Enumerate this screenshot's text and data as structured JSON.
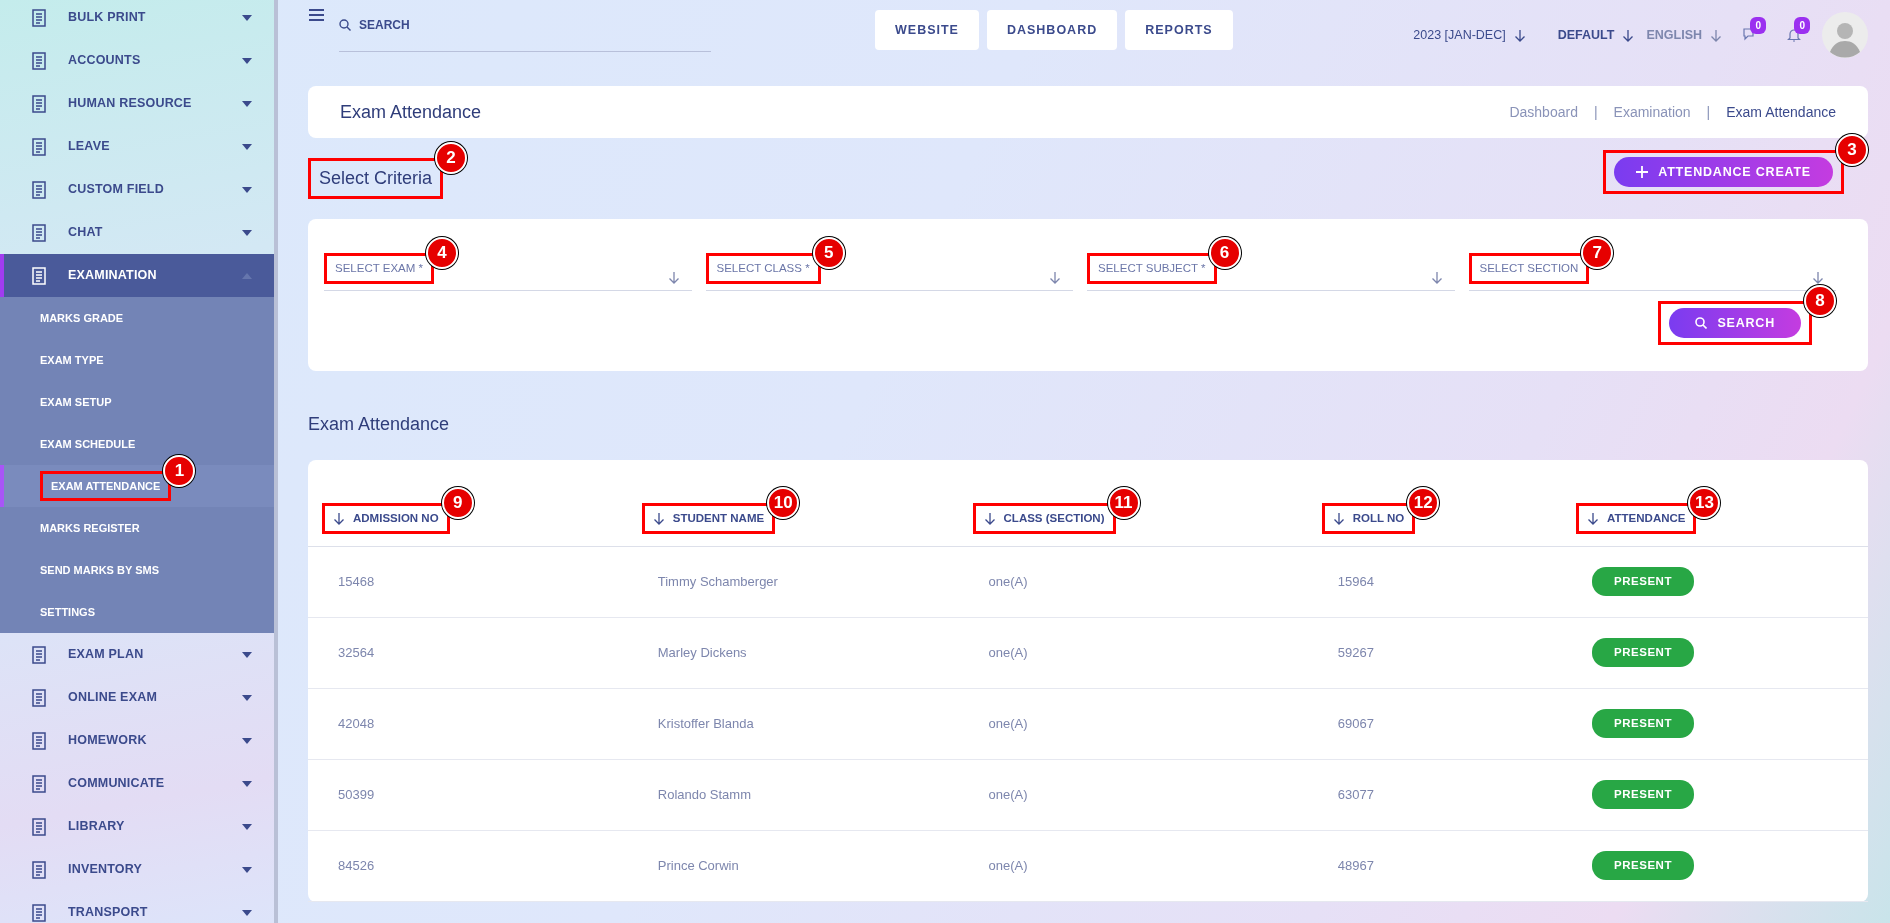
{
  "sidebar": {
    "items": [
      {
        "label": "BULK PRINT",
        "expanded": false,
        "selected": false
      },
      {
        "label": "ACCOUNTS",
        "expanded": false,
        "selected": false
      },
      {
        "label": "HUMAN RESOURCE",
        "expanded": false,
        "selected": false
      },
      {
        "label": "LEAVE",
        "expanded": false,
        "selected": false
      },
      {
        "label": "CUSTOM FIELD",
        "expanded": false,
        "selected": false
      },
      {
        "label": "CHAT",
        "expanded": false,
        "selected": false
      },
      {
        "label": "EXAMINATION",
        "expanded": true,
        "selected": true,
        "children": [
          {
            "label": "MARKS GRADE",
            "selected": false
          },
          {
            "label": "EXAM TYPE",
            "selected": false
          },
          {
            "label": "EXAM SETUP",
            "selected": false
          },
          {
            "label": "EXAM SCHEDULE",
            "selected": false
          },
          {
            "label": "EXAM ATTENDANCE",
            "selected": true,
            "callout": "1"
          },
          {
            "label": "MARKS REGISTER",
            "selected": false
          },
          {
            "label": "SEND MARKS BY SMS",
            "selected": false
          },
          {
            "label": "SETTINGS",
            "selected": false
          }
        ]
      },
      {
        "label": "EXAM PLAN",
        "expanded": false,
        "selected": false
      },
      {
        "label": "ONLINE EXAM",
        "expanded": false,
        "selected": false
      },
      {
        "label": "HOMEWORK",
        "expanded": false,
        "selected": false
      },
      {
        "label": "COMMUNICATE",
        "expanded": false,
        "selected": false
      },
      {
        "label": "LIBRARY",
        "expanded": false,
        "selected": false
      },
      {
        "label": "INVENTORY",
        "expanded": false,
        "selected": false
      },
      {
        "label": "TRANSPORT",
        "expanded": false,
        "selected": false
      }
    ]
  },
  "topbar": {
    "search": {
      "placeholder": "SEARCH"
    },
    "nav_buttons": [
      "WEBSITE",
      "DASHBOARD",
      "REPORTS"
    ],
    "session": "2023 [JAN-DEC]",
    "theme": "DEFAULT",
    "language": "ENGLISH",
    "message_count": "0",
    "notification_count": "0"
  },
  "page_header": {
    "title": "Exam Attendance",
    "separator": "|",
    "breadcrumb": [
      {
        "label": "Dashboard",
        "selected": false
      },
      {
        "label": "Examination",
        "selected": false
      },
      {
        "label": "Exam Attendance",
        "selected": true
      }
    ]
  },
  "criteria": {
    "title": "Select Criteria",
    "title_callout": "2",
    "create_button": {
      "label": "ATTENDANCE CREATE",
      "callout": "3"
    },
    "fields": [
      {
        "placeholder": "SELECT EXAM *",
        "callout": "4"
      },
      {
        "placeholder": "SELECT CLASS *",
        "callout": "5"
      },
      {
        "placeholder": "SELECT SUBJECT *",
        "callout": "6"
      },
      {
        "placeholder": "SELECT SECTION",
        "callout": "7"
      }
    ],
    "search_button": {
      "label": "SEARCH",
      "callout": "8"
    }
  },
  "table": {
    "title": "Exam Attendance",
    "columns": [
      {
        "label": "ADMISSION NO",
        "callout": "9"
      },
      {
        "label": "STUDENT NAME",
        "callout": "10"
      },
      {
        "label": "CLASS (SECTION)",
        "callout": "11"
      },
      {
        "label": "ROLL NO",
        "callout": "12"
      },
      {
        "label": "ATTENDANCE",
        "callout": "13"
      }
    ],
    "rows": [
      {
        "cells": [
          "15468",
          "Timmy Schamberger",
          "one(A)",
          "15964"
        ],
        "attendance": "PRESENT"
      },
      {
        "cells": [
          "32564",
          "Marley Dickens",
          "one(A)",
          "59267"
        ],
        "attendance": "PRESENT"
      },
      {
        "cells": [
          "42048",
          "Kristoffer Blanda",
          "one(A)",
          "69067"
        ],
        "attendance": "PRESENT"
      },
      {
        "cells": [
          "50399",
          "Rolando Stamm",
          "one(A)",
          "63077"
        ],
        "attendance": "PRESENT"
      },
      {
        "cells": [
          "84526",
          "Prince Corwin",
          "one(A)",
          "48967"
        ],
        "attendance": "PRESENT"
      }
    ]
  }
}
